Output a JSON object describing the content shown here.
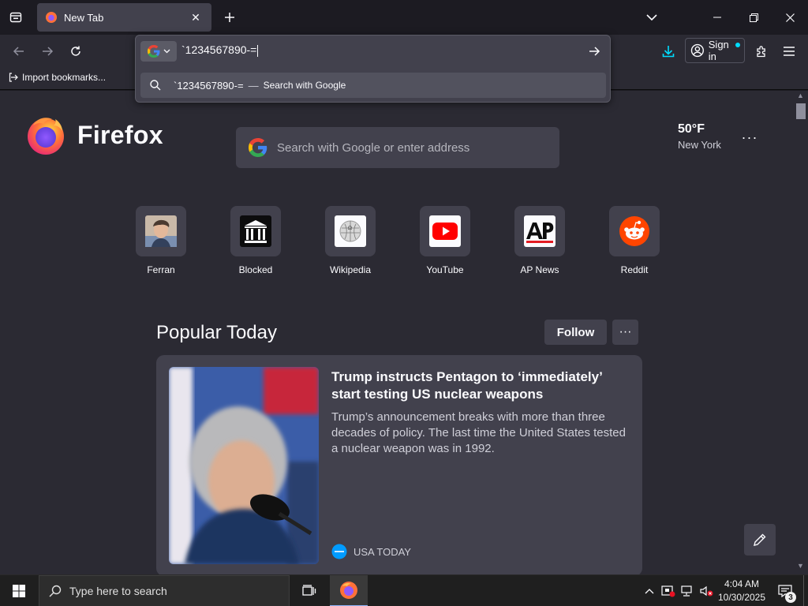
{
  "browser": {
    "tab": {
      "title": "New Tab"
    },
    "bookmarks": {
      "import_label": "Import bookmarks..."
    },
    "signin_label": "Sign in"
  },
  "urlbar": {
    "value": "`1234567890-=",
    "suggestion": {
      "query": "`1234567890-=",
      "separator": "—",
      "action": "Search with Google"
    }
  },
  "newtab": {
    "brand": "Firefox",
    "search_placeholder": "Search with Google or enter address",
    "weather": {
      "temp": "50°F",
      "city": "New York"
    },
    "tiles": [
      {
        "label": "Ferran",
        "icon": "avatar-photo"
      },
      {
        "label": "Blocked",
        "icon": "building-icon"
      },
      {
        "label": "Wikipedia",
        "icon": "wikipedia-globe-icon"
      },
      {
        "label": "YouTube",
        "icon": "youtube-icon"
      },
      {
        "label": "AP News",
        "icon": "ap-logo"
      },
      {
        "label": "Reddit",
        "icon": "reddit-icon"
      }
    ],
    "section": {
      "title": "Popular Today",
      "follow_label": "Follow",
      "more_label": "···"
    },
    "story": {
      "headline": "Trump instructs Pentagon to ‘immediately’ start testing US nuclear weapons",
      "excerpt": "Trump’s announcement breaks with more than three decades of policy. The last time the United States tested a nuclear weapon was in 1992.",
      "source": "USA TODAY"
    }
  },
  "taskbar": {
    "search_placeholder": "Type here to search",
    "time": "4:04 AM",
    "date": "10/30/2025",
    "notification_count": "3"
  },
  "colors": {
    "accent": "#00ddff",
    "page_bg": "#2b2a33",
    "card_bg": "#42414d",
    "firefox_orange": "#ff7139",
    "firefox_purple": "#9059ff"
  }
}
